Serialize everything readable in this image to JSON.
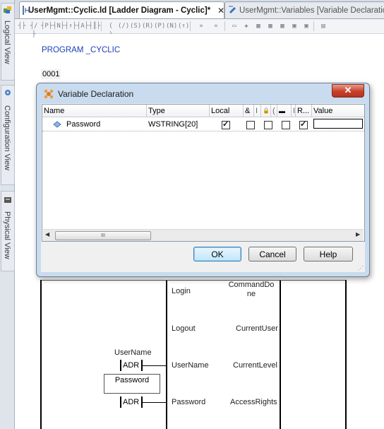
{
  "sidebar": {
    "tabs": [
      {
        "label": "Logical View",
        "icon": "logical-view-icon"
      },
      {
        "label": "Configuration View",
        "icon": "configuration-view-icon"
      },
      {
        "label": "Physical View",
        "icon": "physical-view-icon"
      }
    ]
  },
  "doc_tabs": [
    {
      "title": "UserMgmt::Cyclic.ld [Ladder Diagram - Cyclic]*",
      "close": "✕",
      "active": true
    },
    {
      "title": "UserMgmt::Variables [Variable Declaration]",
      "active": false
    }
  ],
  "editor": {
    "program_header": "PROGRAM _CYCLIC",
    "network_number": "0001",
    "block_inputs": [
      {
        "pin": "Login"
      },
      {
        "pin": "Logout"
      },
      {
        "pin": "UserName",
        "connection": "ADR",
        "variable": "UserName"
      },
      {
        "pin": "Password",
        "connection": "ADR"
      }
    ],
    "block_outputs": [
      "CommandDone",
      "CurrentUser",
      "CurrentLevel",
      "AccessRights"
    ],
    "password_box_label": "Password"
  },
  "dialog": {
    "title": "Variable Declaration",
    "close_symbol": "✕",
    "columns": [
      "Name",
      "Type",
      "Local",
      "&",
      "I",
      "🔒",
      "(",
      "▬",
      "I",
      "R...",
      "Value"
    ],
    "rows": [
      {
        "name": "Password",
        "type": "WSTRING[20]",
        "local": true,
        "c1": false,
        "c2": false,
        "c3": false,
        "retain": true,
        "value": ""
      }
    ],
    "scroll_thumb_glyph": "III",
    "buttons": {
      "ok": "OK",
      "cancel": "Cancel",
      "help": "Help"
    }
  },
  "colors": {
    "program_header": "#1a3fb8",
    "dialog_frame": "#c9dbee",
    "close_button": "#c8402c"
  }
}
